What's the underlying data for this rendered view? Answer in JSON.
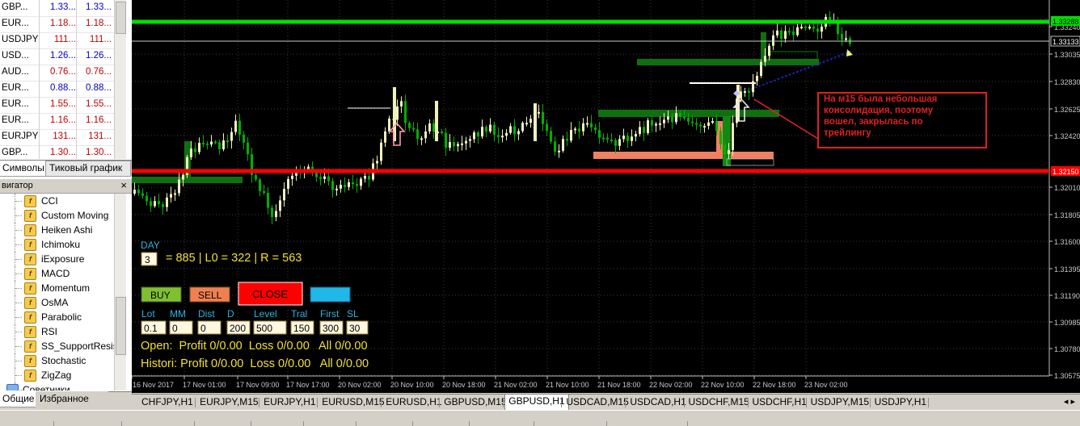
{
  "market_watch": {
    "rows": [
      {
        "symbol": "GBP...",
        "bid": "1.33...",
        "ask": "1.33...",
        "dir": "up"
      },
      {
        "symbol": "EUR...",
        "bid": "1.18...",
        "ask": "1.18...",
        "dir": "down"
      },
      {
        "symbol": "USDJPY",
        "bid": "111...",
        "ask": "111...",
        "dir": "down"
      },
      {
        "symbol": "USD...",
        "bid": "1.26...",
        "ask": "1.26...",
        "dir": "up"
      },
      {
        "symbol": "AUD...",
        "bid": "0.76...",
        "ask": "0.76...",
        "dir": "down"
      },
      {
        "symbol": "EUR...",
        "bid": "0.88...",
        "ask": "0.88...",
        "dir": "up"
      },
      {
        "symbol": "EUR...",
        "bid": "1.55...",
        "ask": "1.55...",
        "dir": "down"
      },
      {
        "symbol": "EUR...",
        "bid": "1.16...",
        "ask": "1.16...",
        "dir": "down"
      },
      {
        "symbol": "EURJPY",
        "bid": "131...",
        "ask": "131...",
        "dir": "down"
      },
      {
        "symbol": "GBP...",
        "bid": "1.30...",
        "ask": "1.30...",
        "dir": "down"
      }
    ],
    "tabs": [
      "Символы",
      "Тиковый график"
    ]
  },
  "navigator": {
    "title": "вигатор",
    "close": "×",
    "items": [
      "CCI",
      "Custom Moving",
      "Heiken Ashi",
      "Ichimoku",
      "iExposure",
      "MACD",
      "Momentum",
      "OsMA",
      "Parabolic",
      "RSI",
      "SS_SupportResist",
      "Stochastic",
      "ZigZag",
      "Советники"
    ],
    "tabs": [
      "Общие",
      "Избранное"
    ]
  },
  "chart": {
    "price_labels": [
      "1.33240",
      "1.33035",
      "1.32830",
      "1.32625",
      "1.32420",
      "1.32010",
      "1.31805",
      "1.31600",
      "1.31395",
      "1.31190",
      "1.30985",
      "1.30780",
      "1.30575"
    ],
    "price_tags": {
      "green": "1.33288",
      "white": "1.33133",
      "red": "1.32150"
    },
    "time_labels": [
      "16 Nov 2017",
      "17 Nov 01:00",
      "17 Nov 09:00",
      "17 Nov 17:00",
      "20 Nov 02:00",
      "20 Nov 10:00",
      "20 Nov 18:00",
      "21 Nov 02:00",
      "21 Nov 10:00",
      "21 Nov 18:00",
      "22 Nov 02:00",
      "22 Nov 10:00",
      "22 Nov 18:00",
      "23 Nov 02:00"
    ],
    "annotation": "На м15 была небольшая консолидация, поэтому вошел, закрылась по трейлингу",
    "panel": {
      "day_label": "DAY",
      "day_value": "3",
      "stats": "= 885 | L0 = 322 | R = 563",
      "buy": "BUY",
      "sell": "SELL",
      "close": "CLOSE",
      "param_labels": [
        "Lot",
        "MM",
        "Dist",
        "D",
        "Level",
        "Tral",
        "First",
        "SL"
      ],
      "param_values": [
        "0.1",
        "0",
        "0",
        "200",
        "500",
        "150",
        "300",
        "30"
      ],
      "open_line": "Open:  Profit 0/0.00  Loss 0/0.00   All 0/0.00",
      "history_line": "Histori: Profit 0/0.00  Loss 0/0.00   All 0/0.00"
    }
  },
  "bottom_tabs": [
    "CHFJPY,H1",
    "EURJPY,M15",
    "EURJPY,H1",
    "EURUSD,M15",
    "EURUSD,H1",
    "GBPUSD,M15",
    "GBPUSD,H1",
    "USDCAD,M15",
    "USDCAD,H1",
    "USDCHF,M15",
    "USDCHF,H1",
    "USDJPY,M15",
    "USDJPY,H1"
  ],
  "active_bottom_tab": "GBPUSD,H1",
  "colors": {
    "background": "#000000",
    "green_line": "#00e000",
    "red_line": "#ff0000",
    "bull": "#f0f0c0",
    "bear": "#00b000",
    "grid": "#3a3a3a",
    "panel_text": "#f0e030"
  }
}
